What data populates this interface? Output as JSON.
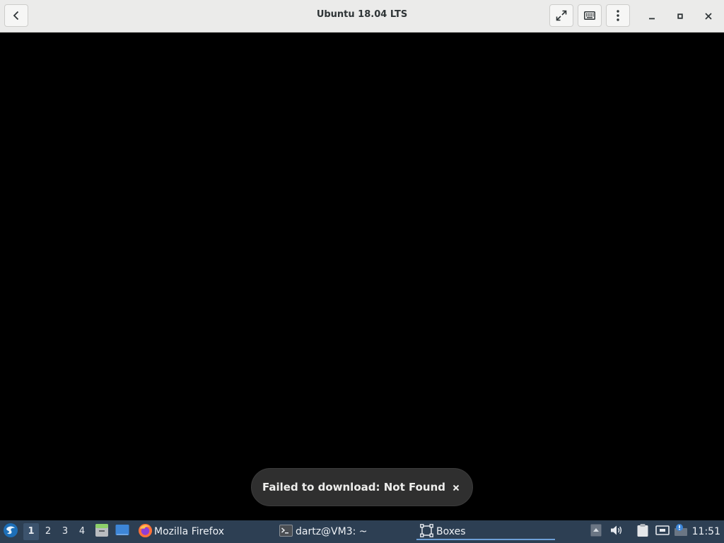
{
  "window": {
    "title": "Ubuntu 18.04 LTS"
  },
  "header": {
    "icons": [
      "back-icon",
      "fullscreen-icon",
      "keyboard-icon",
      "menu-icon",
      "minimize-icon",
      "maximize-icon",
      "close-icon"
    ]
  },
  "toast": {
    "message": "Failed to download: Not Found",
    "close_icon": "close-icon"
  },
  "taskbar": {
    "workspaces": [
      "1",
      "2",
      "3",
      "4"
    ],
    "active_workspace": "1",
    "tasks": [
      {
        "label": "Mozilla Firefox",
        "icon": "firefox-icon"
      },
      {
        "label": "dartz@VM3: ~",
        "icon": "terminal-icon"
      },
      {
        "label": "Boxes",
        "icon": "boxes-icon"
      }
    ],
    "active_task": "Boxes",
    "clock": "11:51"
  },
  "colors": {
    "header_bg": "#ebebea",
    "taskbar_bg": "#2d3f53",
    "toast_bg": "#2f2f2f",
    "accent": "#6ea0d8"
  }
}
